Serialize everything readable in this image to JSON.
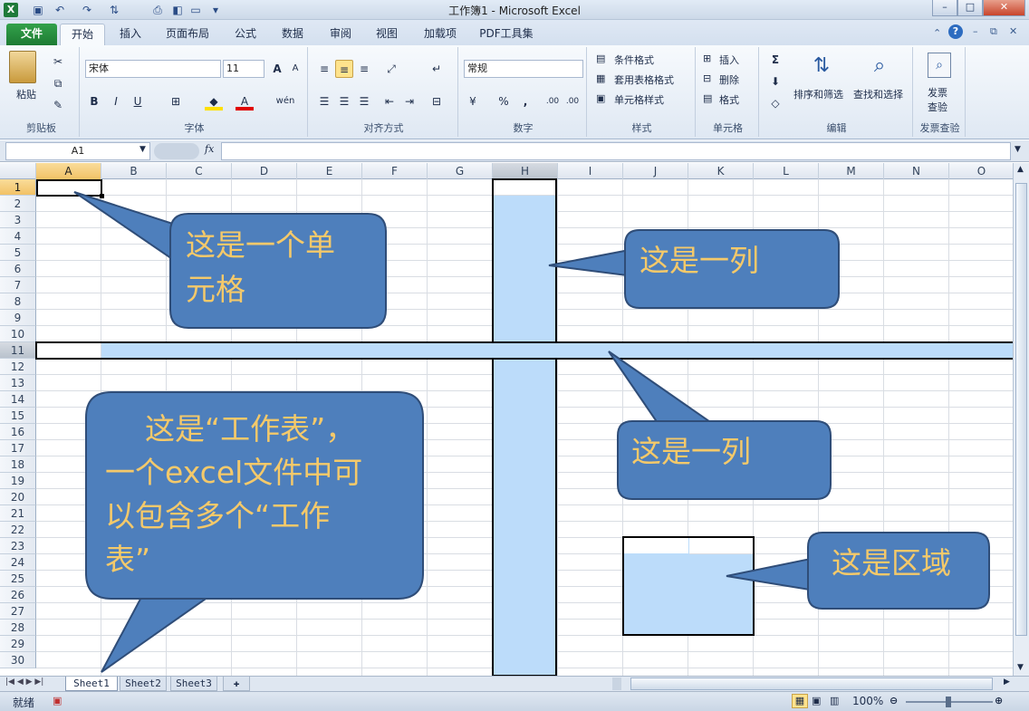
{
  "window": {
    "title": "工作簿1 - Microsoft Excel",
    "logo_letter": "X"
  },
  "tabs": [
    "文件",
    "开始",
    "插入",
    "页面布局",
    "公式",
    "数据",
    "审阅",
    "视图",
    "加载项",
    "PDF工具集"
  ],
  "ribbon": {
    "clipboard": {
      "paste": "粘贴",
      "label": "剪贴板"
    },
    "font": {
      "name": "宋体",
      "size": "11",
      "label": "字体",
      "bold": "B",
      "italic": "I",
      "underline": "U",
      "grow": "A",
      "shrink": "A",
      "font_color": "A",
      "phonetic": "wén"
    },
    "alignment": {
      "label": "对齐方式"
    },
    "number": {
      "format": "常规",
      "label": "数字",
      "percent": "%",
      "comma": ",",
      "inc_dec": ".00",
      "dec_dec": ".00"
    },
    "styles": {
      "conditional": "条件格式",
      "table": "套用表格格式",
      "cell": "单元格样式",
      "label": "样式"
    },
    "cells": {
      "insert": "插入",
      "delete": "删除",
      "format": "格式",
      "label": "单元格"
    },
    "editing": {
      "sum": "Σ",
      "sort": "排序和筛选",
      "find": "查找和选择",
      "label": "编辑"
    },
    "invoice": {
      "line1": "发票",
      "line2": "查验",
      "label": "发票查验"
    }
  },
  "formula_bar": {
    "name_box": "A1",
    "fx": "fx",
    "value": ""
  },
  "columns": [
    "A",
    "B",
    "C",
    "D",
    "E",
    "F",
    "G",
    "H",
    "I",
    "J",
    "K",
    "L",
    "M",
    "N",
    "O"
  ],
  "rows": [
    "1",
    "2",
    "3",
    "4",
    "5",
    "6",
    "7",
    "8",
    "9",
    "10",
    "11",
    "12",
    "13",
    "14",
    "15",
    "16",
    "17",
    "18",
    "19",
    "20",
    "21",
    "22",
    "23",
    "24",
    "25",
    "26",
    "27",
    "28",
    "29",
    "30"
  ],
  "sheets": [
    "Sheet1",
    "Sheet2",
    "Sheet3"
  ],
  "status": {
    "ready": "就绪",
    "zoom": "100%"
  },
  "annotations": {
    "cell": [
      "这是一个单",
      "元格"
    ],
    "column": "这是一列",
    "row": "这是一列",
    "sheet": [
      "这是“工作表”，",
      "一个excel文件中可",
      "以包含多个“工作",
      "表”"
    ],
    "range": "这是区域"
  },
  "colors": {
    "callout_fill": "#4e7fbc",
    "callout_text": "#f4c96a",
    "selection": "#bcdcfa",
    "file_tab": "#2a8c41"
  }
}
